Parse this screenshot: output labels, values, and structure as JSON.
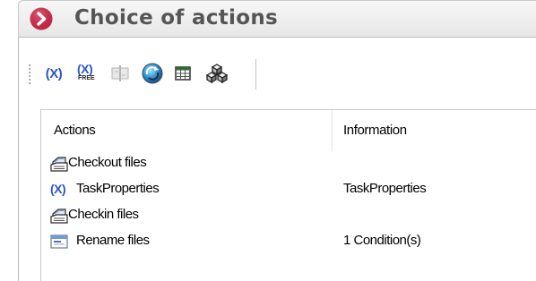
{
  "window": {
    "title": "Choice of actions",
    "accent_color": "#d6274a",
    "title_icon": "chevron-right-circle-icon"
  },
  "toolbar": {
    "buttons": [
      {
        "name": "task-properties-icon",
        "glyph": "(X)"
      },
      {
        "name": "free-variable-icon",
        "glyph": "(X)",
        "sublabel": "FREE"
      },
      {
        "name": "condition-icon"
      },
      {
        "name": "refresh-icon"
      },
      {
        "name": "table-icon"
      },
      {
        "name": "components-icon"
      }
    ]
  },
  "list": {
    "columns": [
      "Actions",
      "Information"
    ],
    "rows": [
      {
        "icon": "checkout-files-icon",
        "action": "Checkout files",
        "info": ""
      },
      {
        "icon": "task-properties-icon",
        "icon_glyph": "(X)",
        "action": "TaskProperties",
        "info": "TaskProperties"
      },
      {
        "icon": "checkin-files-icon",
        "action": "Checkin files",
        "info": ""
      },
      {
        "icon": "rename-files-icon",
        "action": "Rename files",
        "info": "1 Condition(s)"
      }
    ]
  }
}
